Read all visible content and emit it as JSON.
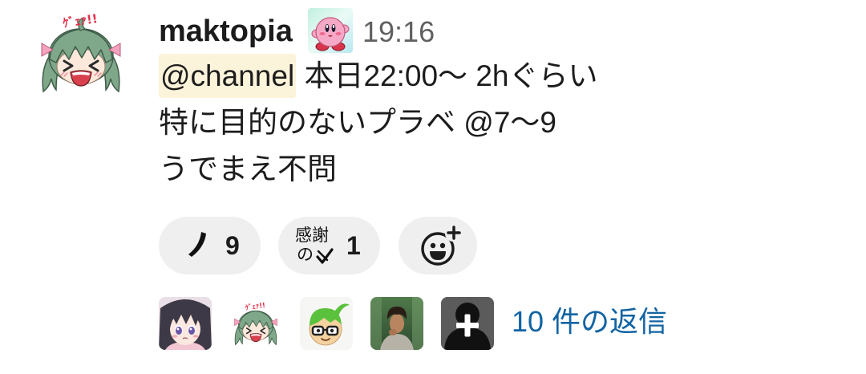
{
  "message": {
    "author": "maktopia",
    "author_avatar_icon": "green-hair-girl-sticker",
    "avatar_lettering": "ｹﾞｪｧ!!",
    "author_badge_icon": "kirby-emoji",
    "timestamp": "19:16",
    "mention": "@channel",
    "line1_rest": "本日22:00〜 2hぐらい",
    "line2": "特に目的のないプラベ @7〜9",
    "line3": "うでまえ不問"
  },
  "reactions": [
    {
      "emoji_icon": "katakana-no-emoji",
      "count": "9"
    },
    {
      "emoji_icon": "kansha-no-check-emoji",
      "emoji_text_top": "感謝",
      "emoji_text_bottom": "の",
      "count": "1"
    }
  ],
  "add_reaction": {
    "icon": "add-reaction-icon"
  },
  "thread": {
    "reply_avatar_icons": [
      "dark-hair-anime-girl-avatar",
      "green-hair-girl-sticker",
      "inkling-with-glasses-avatar",
      "person-photo-avatar",
      "default-user-plus-avatar"
    ],
    "reply_label": "10 件の返信"
  },
  "colors": {
    "text": "#1d1c1d",
    "muted": "#616061",
    "link": "#1264a3",
    "mention_bg": "#fcf4da",
    "reaction_bg": "#efefef"
  }
}
